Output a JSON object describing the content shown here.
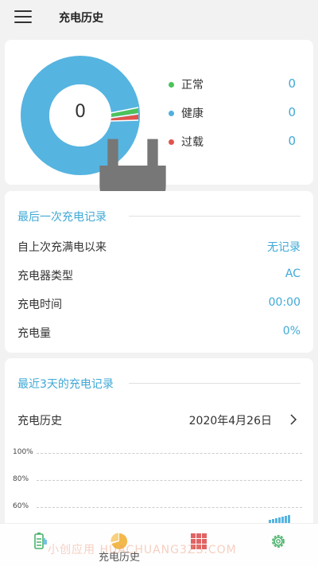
{
  "header": {
    "title": "充电历史"
  },
  "summary": {
    "center_value": "0",
    "legend": [
      {
        "label": "正常",
        "value": "0",
        "color": "#4cc35a"
      },
      {
        "label": "健康",
        "value": "0",
        "color": "#4fb0de"
      },
      {
        "label": "过载",
        "value": "0",
        "color": "#e0544b"
      }
    ]
  },
  "last_record": {
    "title": "最后一次充电记录",
    "rows": [
      {
        "label": "自上次充满电以来",
        "value": "无记录"
      },
      {
        "label": "充电器类型",
        "value": "AC"
      },
      {
        "label": "充电时间",
        "value": "00:00"
      },
      {
        "label": "充电量",
        "value": "0%"
      }
    ]
  },
  "recent": {
    "title": "最近3天的充电记录",
    "history_label": "充电历史",
    "date": "2020年4月26日",
    "axis_ticks": [
      "100%",
      "80%",
      "60%"
    ]
  },
  "bottom_nav": {
    "items": [
      {
        "label": "",
        "icon": "battery-icon"
      },
      {
        "label": "充电历史",
        "icon": "pie-chart-icon"
      },
      {
        "label": "",
        "icon": "grid-icon"
      },
      {
        "label": "",
        "icon": "gear-icon"
      }
    ],
    "watermark": "小创应用 HUACHUANG3ZS.COM"
  }
}
